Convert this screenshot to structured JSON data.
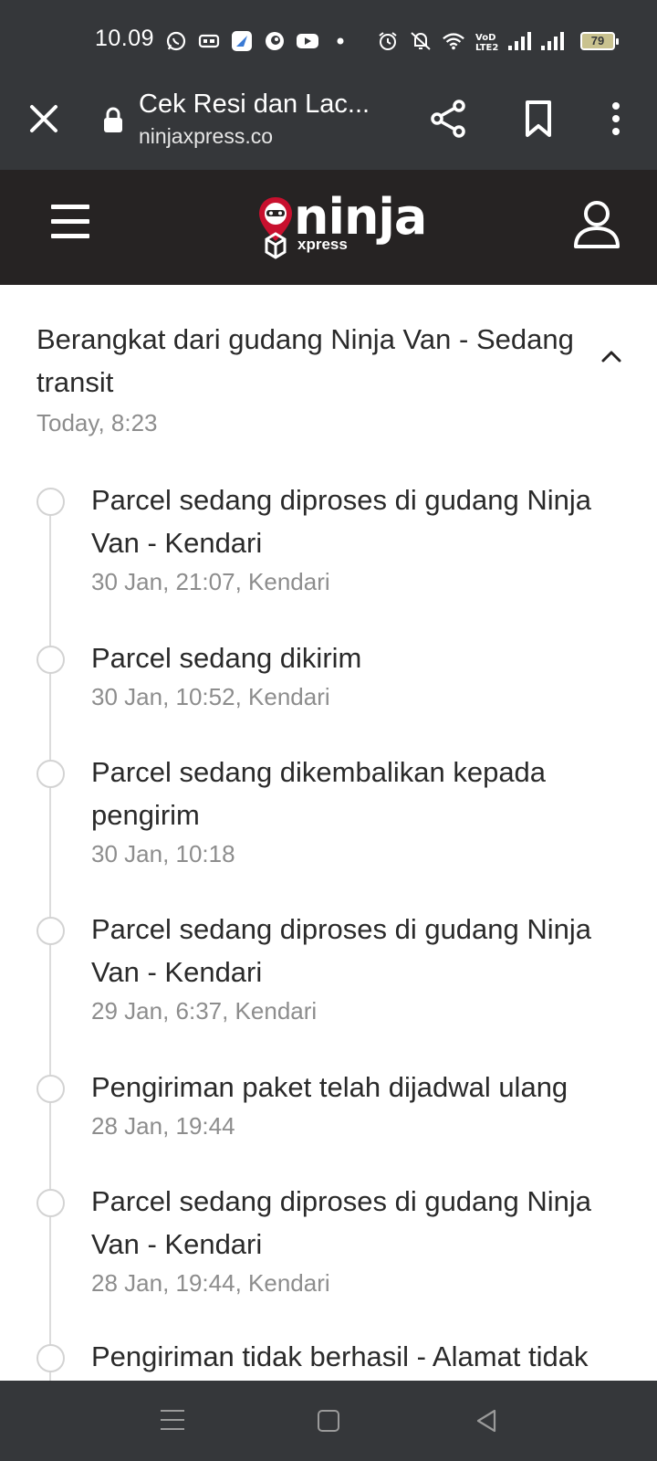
{
  "status_bar": {
    "time": "10.09",
    "battery": "79",
    "icons": [
      "whatsapp-icon",
      "message-icon",
      "app-icon",
      "app-icon",
      "youtube-icon",
      "dot-icon",
      "alarm-icon",
      "mute-icon",
      "wifi-icon",
      "volte-icon",
      "signal-icon",
      "signal-icon"
    ]
  },
  "browser": {
    "title": "Cek Resi dan Lac...",
    "url": "ninjaxpress.co"
  },
  "site": {
    "logo_word": "ninja",
    "logo_sub": "xpress"
  },
  "tracking": {
    "latest": {
      "title": "Berangkat dari gudang Ninja Van - Sedang transit",
      "time": "Today, 8:23"
    },
    "events": [
      {
        "title": "Parcel sedang diproses di gudang Ninja Van - Kendari",
        "meta": "30 Jan, 21:07, Kendari"
      },
      {
        "title": "Parcel sedang dikirim",
        "meta": "30 Jan, 10:52, Kendari"
      },
      {
        "title": "Parcel sedang dikembalikan kepada pengirim",
        "meta": "30 Jan, 10:18"
      },
      {
        "title": "Parcel sedang diproses di gudang Ninja Van - Kendari",
        "meta": "29 Jan, 6:37, Kendari"
      },
      {
        "title": "Pengiriman paket telah dijadwal ulang",
        "meta": "28 Jan, 19:44"
      },
      {
        "title": "Parcel sedang diproses di gudang Ninja Van - Kendari",
        "meta": "28 Jan, 19:44, Kendari"
      },
      {
        "title": "Pengiriman tidak berhasil - Alamat tidak",
        "meta": ""
      }
    ]
  },
  "colors": {
    "bar": "#35373a",
    "header": "#262323",
    "brand_red": "#c8102e"
  }
}
